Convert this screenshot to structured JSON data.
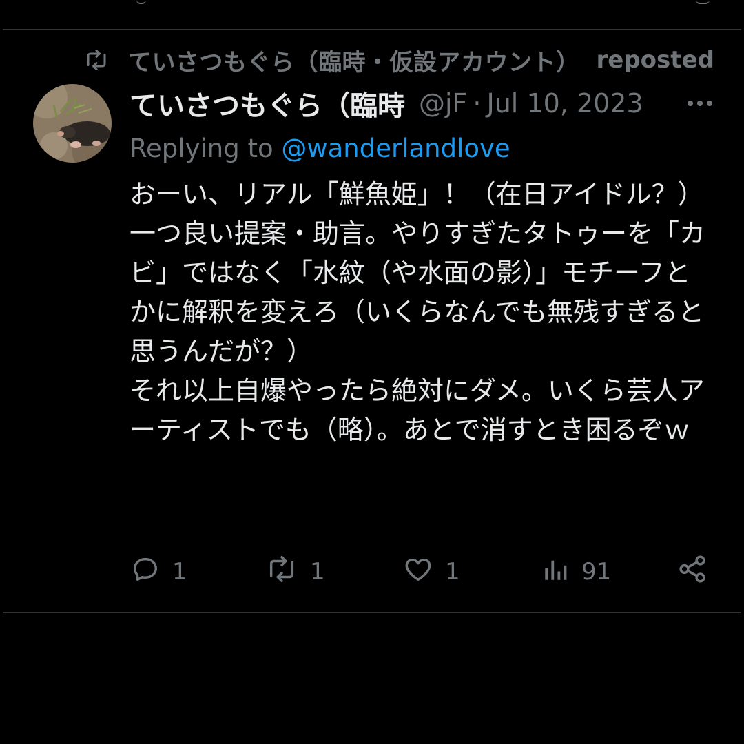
{
  "repost_banner": {
    "icon": "repost-icon",
    "name": "ていさつもぐら（臨時・仮設アカウント）",
    "label": "reposted"
  },
  "tweet": {
    "avatar_icon": "mole-avatar",
    "display_name": "ていさつもぐら（臨時",
    "handle": "@jF",
    "separator": "·",
    "date": "Jul 10, 2023",
    "more_icon": "more-horizontal-icon",
    "replying_to_prefix": "Replying to ",
    "replying_to_handle": "@wanderlandlove",
    "body": "おーい、リアル「鮮魚姫」！（在日アイドル？）\n一つ良い提案・助言。やりすぎたタトゥーを「カビ」ではなく「水紋（や水面の影）」モチーフとかに解釈を変えろ（いくらなんでも無残すぎると思うんだが？）\nそれ以上自爆やったら絶対にダメ。いくら芸人アーティストでも（略）。あとで消すとき困るぞｗ"
  },
  "actions": {
    "reply": {
      "icon": "reply-icon",
      "count": "1"
    },
    "repost": {
      "icon": "repost-icon",
      "count": "1"
    },
    "like": {
      "icon": "heart-icon",
      "count": "1"
    },
    "views": {
      "icon": "views-icon",
      "count": "91"
    },
    "share": {
      "icon": "share-icon"
    }
  },
  "colors": {
    "background": "#000000",
    "text_primary": "#e7e9ea",
    "text_secondary": "#71767b",
    "accent": "#1d9bf0",
    "divider": "#2f3336"
  }
}
